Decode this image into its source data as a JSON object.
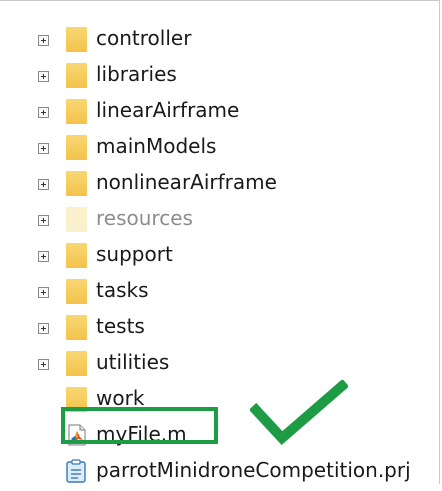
{
  "tree": {
    "items": [
      {
        "label": "controller",
        "type": "folder",
        "expandable": true,
        "dim": false
      },
      {
        "label": "libraries",
        "type": "folder",
        "expandable": true,
        "dim": false
      },
      {
        "label": "linearAirframe",
        "type": "folder",
        "expandable": true,
        "dim": false
      },
      {
        "label": "mainModels",
        "type": "folder",
        "expandable": true,
        "dim": false
      },
      {
        "label": "nonlinearAirframe",
        "type": "folder",
        "expandable": true,
        "dim": false
      },
      {
        "label": "resources",
        "type": "folder",
        "expandable": true,
        "dim": true
      },
      {
        "label": "support",
        "type": "folder",
        "expandable": true,
        "dim": false
      },
      {
        "label": "tasks",
        "type": "folder",
        "expandable": true,
        "dim": false
      },
      {
        "label": "tests",
        "type": "folder",
        "expandable": true,
        "dim": false
      },
      {
        "label": "utilities",
        "type": "folder",
        "expandable": true,
        "dim": false
      },
      {
        "label": "work",
        "type": "folder",
        "expandable": false,
        "dim": false
      },
      {
        "label": "myFile.m",
        "type": "m-file",
        "expandable": false,
        "dim": false
      },
      {
        "label": "parrotMinidroneCompetition.prj",
        "type": "project-file",
        "expandable": false,
        "dim": false
      }
    ]
  },
  "colors": {
    "highlight": "#1e9b45",
    "checkmark": "#1e9b45",
    "folder": "#f3c24a"
  }
}
